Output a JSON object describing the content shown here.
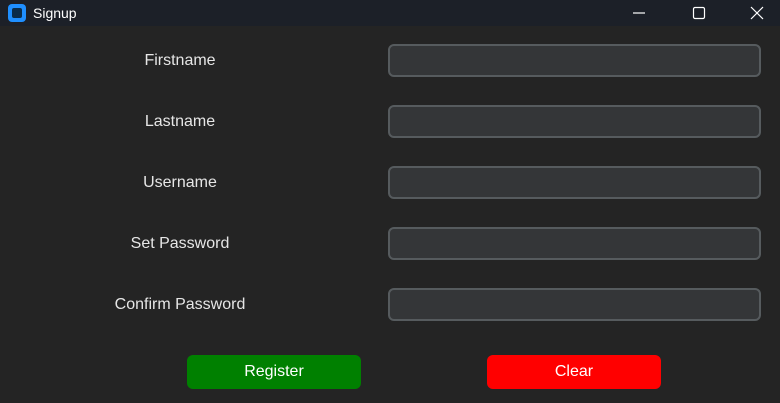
{
  "window": {
    "title": "Signup",
    "icon": "app-icon",
    "controls": [
      "minimize-icon",
      "maximize-icon",
      "close-icon"
    ]
  },
  "form": {
    "fields": [
      {
        "label": "Firstname",
        "value": "",
        "placeholder": ""
      },
      {
        "label": "Lastname",
        "value": "",
        "placeholder": ""
      },
      {
        "label": "Username",
        "value": "",
        "placeholder": ""
      },
      {
        "label": "Set Password",
        "value": "",
        "placeholder": ""
      },
      {
        "label": "Confirm Password",
        "value": "",
        "placeholder": ""
      }
    ]
  },
  "actions": {
    "register_label": "Register",
    "clear_label": "Clear"
  },
  "colors": {
    "background": "#242424",
    "titlebar": "#1c2028",
    "register": "#008000",
    "clear": "#ff0000",
    "input_bg": "#343638",
    "input_border": "#565b5e"
  }
}
